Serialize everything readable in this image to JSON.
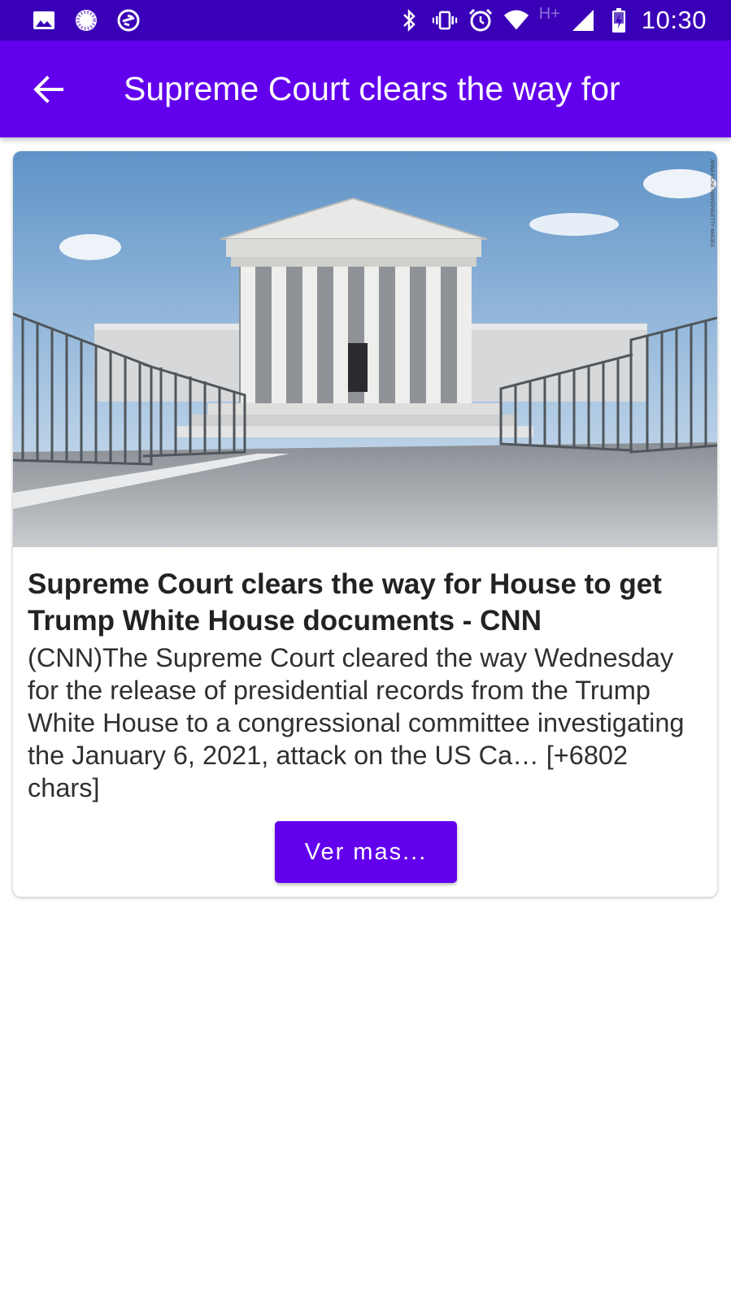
{
  "status_bar": {
    "time": "10:30",
    "network": "H+",
    "icons_left": [
      "image-icon",
      "loader-icon",
      "sync-icon"
    ],
    "icons_right": [
      "bluetooth-icon",
      "vibrate-icon",
      "alarm-icon",
      "wifi-icon",
      "signal-icon",
      "battery-charging-icon"
    ]
  },
  "app_bar": {
    "title": "Supreme Court clears the way for",
    "back_icon": "arrow-left-icon",
    "background": "#6200ee"
  },
  "article": {
    "title": "Supreme Court clears the way for House to get Trump White House documents - CNN",
    "description": "(CNN)The Supreme Court cleared the way Wednesday for the release of presidential records from the Trump White House to a congressional committee investigating the January 6, 2021, attack on the US Ca… [+6802 chars]",
    "image_credit": "ANNA MONEYMAKER/GETTY IMAGES",
    "more_button": "Ver mas..."
  },
  "colors": {
    "status_bar": "#3a00b8",
    "primary": "#6200ee"
  }
}
